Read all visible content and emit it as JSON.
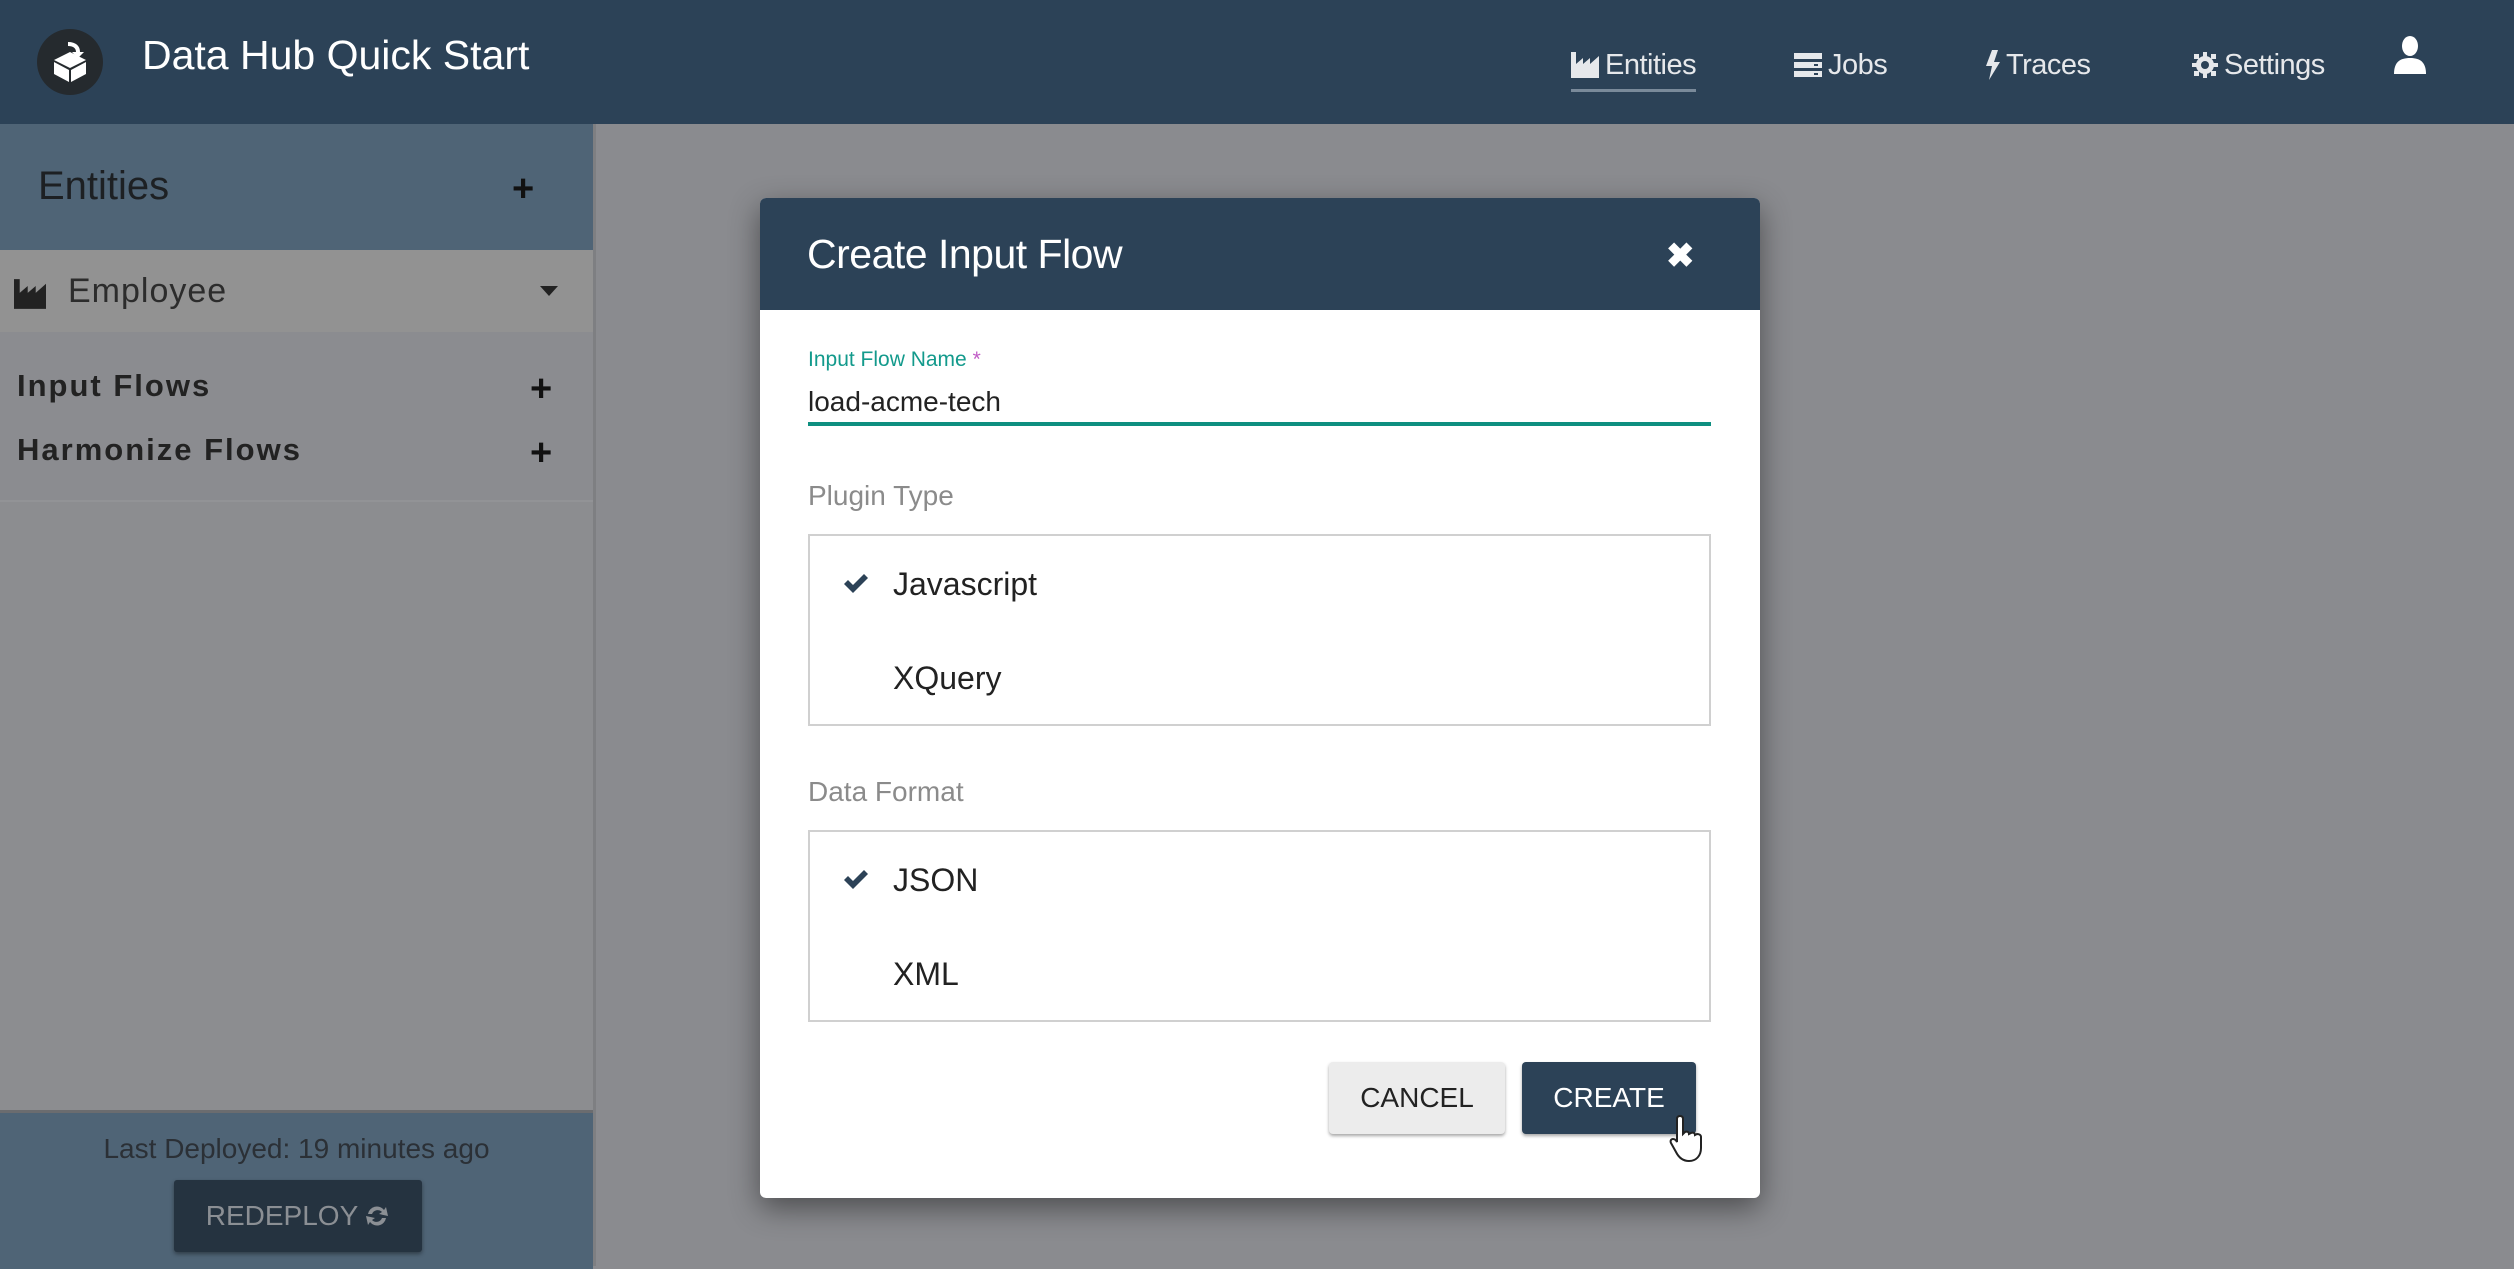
{
  "app": {
    "title": "Data Hub Quick Start",
    "logo_icon": "box-download-icon"
  },
  "nav": [
    {
      "label": "Entities",
      "icon": "factory-icon",
      "active": true
    },
    {
      "label": "Jobs",
      "icon": "server-icon",
      "active": false
    },
    {
      "label": "Traces",
      "icon": "bolt-icon",
      "active": false
    },
    {
      "label": "Settings",
      "icon": "gear-icon",
      "active": false
    }
  ],
  "user_menu": {
    "icon": "user-icon"
  },
  "sidebar": {
    "header": {
      "title": "Entities",
      "add_label": "+"
    },
    "entity": {
      "name": "Employee",
      "icon": "factory-icon",
      "expanded": true
    },
    "flows": [
      {
        "label": "Input Flows",
        "add_label": "+"
      },
      {
        "label": "Harmonize Flows",
        "add_label": "+"
      }
    ],
    "footer": {
      "last_deployed": "Last Deployed: 19 minutes ago",
      "redeploy_label": "REDEPLOY",
      "redeploy_icon": "refresh-icon"
    }
  },
  "dialog": {
    "title": "Create Input Flow",
    "close_label": "✖",
    "name_field": {
      "label": "Input Flow Name",
      "required_marker": "*",
      "value": "load-acme-tech"
    },
    "plugin_type": {
      "label": "Plugin Type",
      "options": [
        {
          "label": "Javascript",
          "selected": true
        },
        {
          "label": "XQuery",
          "selected": false
        }
      ]
    },
    "data_format": {
      "label": "Data Format",
      "options": [
        {
          "label": "JSON",
          "selected": true
        },
        {
          "label": "XML",
          "selected": false
        }
      ]
    },
    "cancel_label": "CANCEL",
    "create_label": "CREATE"
  },
  "colors": {
    "primary": "#2c4257",
    "accent": "#0e8f80",
    "required": "#c05bc6",
    "sidebar_header": "#4f6476"
  }
}
